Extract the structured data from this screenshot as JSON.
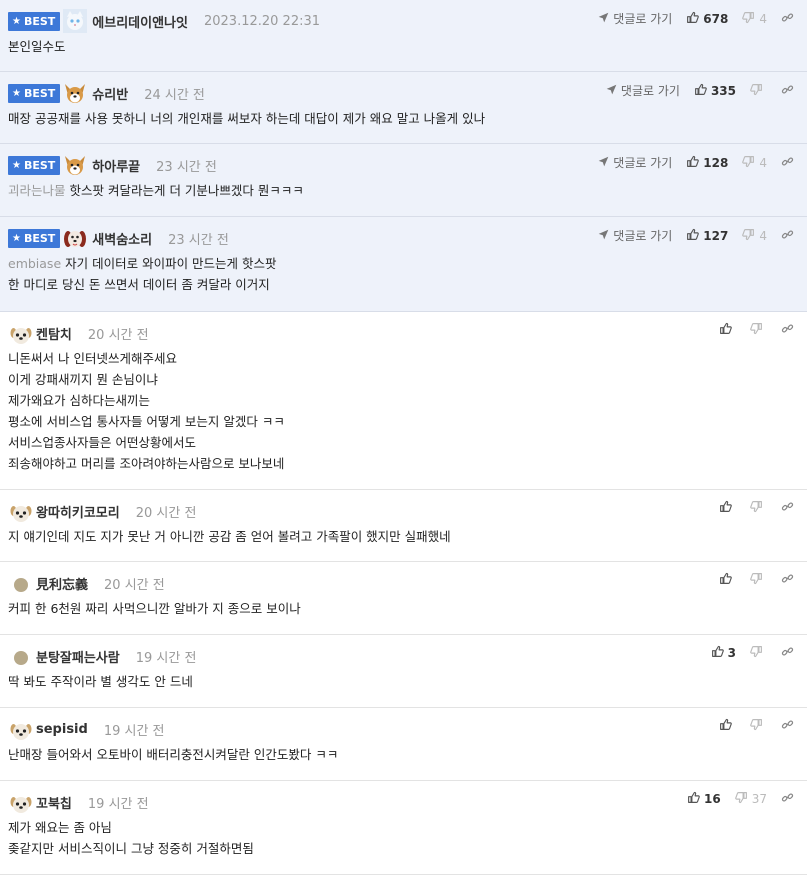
{
  "reply_label": "댓글로 가기",
  "best_label": "BEST",
  "comments": [
    {
      "best": true,
      "nick": "에브리데이앤나잇",
      "time": "2023.12.20 22:31",
      "up": "678",
      "down": "4",
      "ref": "",
      "lines": [
        "본인일수도"
      ],
      "avatar": "cat-white"
    },
    {
      "best": true,
      "nick": "슈리반",
      "time": "24 시간 전",
      "up": "335",
      "down": "",
      "ref": "",
      "lines": [
        "매장 공공재를 사용 못하니 너의 개인재를 써보자 하는데 대답이 제가 왜요 말고 나올게 있나"
      ],
      "avatar": "dog-face"
    },
    {
      "best": true,
      "nick": "하아루끝",
      "time": "23 시간 전",
      "up": "128",
      "down": "4",
      "ref": "괴라는나물",
      "lines": [
        "핫스팟 켜달라는게 더 기분나쁘겠다 뭔ㅋㅋㅋ"
      ],
      "avatar": "dog-face"
    },
    {
      "best": true,
      "nick": "새벽숨소리",
      "time": "23 시간 전",
      "up": "127",
      "down": "4",
      "ref": "embiase",
      "lines": [
        "자기 데이터로 와이파이 만드는게 핫스팟",
        "한 마디로 당신 돈 쓰면서 데이터 좀 켜달라 이거지"
      ],
      "avatar": "dog-red"
    },
    {
      "best": false,
      "nick": "켄탐치",
      "time": "20 시간 전",
      "up": "",
      "down": "",
      "ref": "",
      "lines": [
        "니돈써서 나 인터넷쓰게해주세요",
        "이게 강패새끼지 뭔 손님이냐",
        "제가왜요가 심하다는새끼는",
        "평소에 서비스업 통사자들 어떻게 보는지 알겠다 ㅋㅋ",
        "서비스업종사자들은 어떤상황에서도",
        "죄송해야하고 머리를 조아려야하는사람으로 보나보네"
      ],
      "avatar": "dog-small"
    },
    {
      "best": false,
      "nick": "왕따히키코모리",
      "time": "20 시간 전",
      "up": "",
      "down": "",
      "ref": "",
      "lines": [
        "지 얘기인데 지도 지가 못난 거 아니깐 공감 좀 얻어 볼려고 가족팔이 했지만 실패했네"
      ],
      "avatar": "dog-small"
    },
    {
      "best": false,
      "nick": "見利忘義",
      "time": "20 시간 전",
      "up": "",
      "down": "",
      "ref": "",
      "lines": [
        "커피 한 6천원 짜리 사먹으니깐 알바가 지 종으로 보이나"
      ],
      "avatar": "dot"
    },
    {
      "best": false,
      "nick": "분탕잘패는사람",
      "time": "19 시간 전",
      "up": "3",
      "down": "",
      "ref": "",
      "lines": [
        "딱 봐도 주작이라 별 생각도 안 드네"
      ],
      "avatar": "dot"
    },
    {
      "best": false,
      "nick": "sepisid",
      "time": "19 시간 전",
      "up": "",
      "down": "",
      "ref": "",
      "lines": [
        "난매장 들어와서 오토바이 배터리충전시켜달란 인간도봤다 ㅋㅋ"
      ],
      "avatar": "dog-small"
    },
    {
      "best": false,
      "nick": "꼬북칩",
      "time": "19 시간 전",
      "up": "16",
      "down": "37",
      "ref": "",
      "lines": [
        "제가 왜요는 좀 아님",
        "좆같지만 서비스직이니 그냥 정중히 거절하면됨"
      ],
      "avatar": "dog-small"
    }
  ]
}
